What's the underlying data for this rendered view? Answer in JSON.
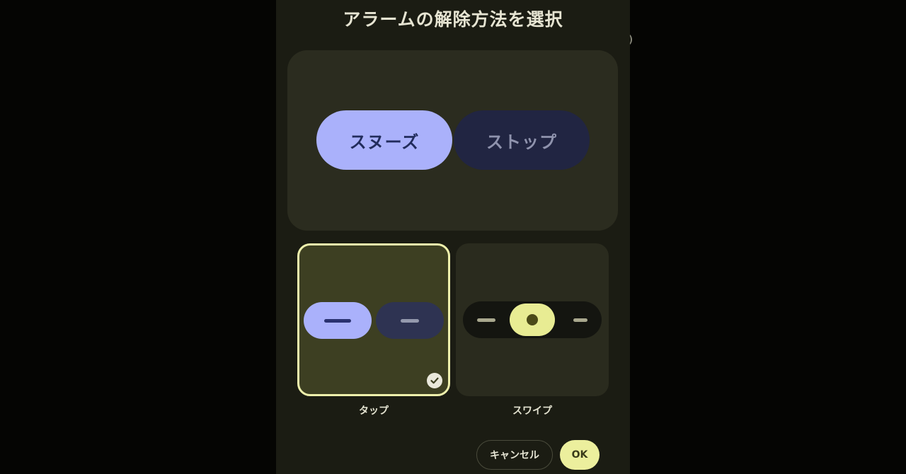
{
  "dialog": {
    "title": "アラームの解除方法を選択"
  },
  "preview": {
    "snooze_label": "スヌーズ",
    "stop_label": "ストップ"
  },
  "options": [
    {
      "label": "タップ",
      "selected": true
    },
    {
      "label": "スワイプ",
      "selected": false
    }
  ],
  "actions": {
    "cancel_label": "キャンセル",
    "ok_label": "OK"
  },
  "colors": {
    "dialog_bg": "#1b1c13",
    "snooze_pill": "#aab1fb",
    "stop_pill": "#212542",
    "selected_border": "#eef0ac",
    "ok_button": "#ecef9d"
  },
  "icons": {
    "selected_badge": "check-circle-icon"
  }
}
